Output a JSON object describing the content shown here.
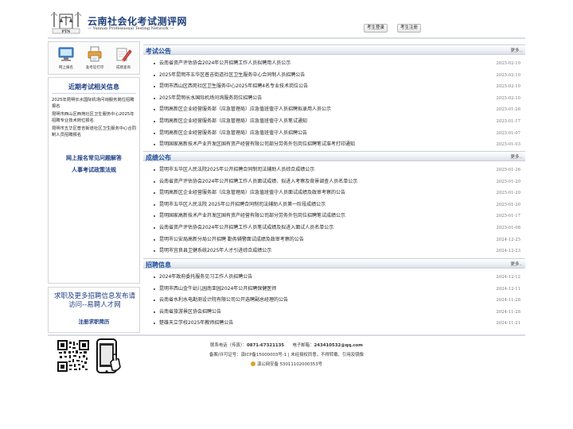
{
  "header": {
    "site_title": "云南社会化考试测评网",
    "site_subtitle": "Yunnan Professional Testing Network",
    "logo_text": "PTN",
    "login_label": "考生登录",
    "register_label": "考生注册"
  },
  "quick_links": [
    {
      "label": "网上报名",
      "icon": "computer-icon"
    },
    {
      "label": "准考证打印",
      "icon": "printer-icon"
    },
    {
      "label": "成绩查询",
      "icon": "pencil-icon"
    }
  ],
  "sidebar": {
    "title": "近期考试相关信息",
    "items": [
      "2025年昆明长水国际机场问询服务岗位招聘报名",
      "昆明市西山区西苑社区卫生服务中心2025年招聘专业技术岗位报名",
      "昆明市五华区普吉街道社区卫生服务中心合同制人员招聘报名"
    ],
    "link_faq": "网上报名常见问题解答",
    "link_policy": "人事考试政策法规"
  },
  "recruit": {
    "text": "求职及更多招聘信息发布请访问--易聘人才网",
    "link": "注册求职简历"
  },
  "sections": [
    {
      "title": "考试公告",
      "more": "更多..",
      "items": [
        {
          "title": "云南省资产评估协会2024年公开招聘工作人员拟聘用人员公示",
          "date": "2025-02-10"
        },
        {
          "title": "2025年昆明市五华区普吉街道社区卫生服务中心合同制人员招聘公告",
          "date": "2025-02-10"
        },
        {
          "title": "昆明市西山区西苑社区卫生服务中心2025年招聘4名专业技术岗位公告",
          "date": "2025-02-10"
        },
        {
          "title": "2025年昆明长水国际机场问询服务岗位招聘公告",
          "date": "2025-02-10"
        },
        {
          "title": "昆明高新区企业经营服务部（应急管理局）应急值班值守人员招聘拟录用人员公示",
          "date": "2025-01-26"
        },
        {
          "title": "昆明高新区企业经营服务部（应急管理局）应急值班值守人员笔试通知",
          "date": "2025-01-17"
        },
        {
          "title": "昆明高新区企业经营服务部（应急管理局）应急值班值守人员招聘公告",
          "date": "2025-01-07"
        },
        {
          "title": "昆明国家高新技术产业开发区国有资产经营有限公司部分劳务外包岗位招聘笔试准考打印通知",
          "date": "2025-01-03"
        }
      ]
    },
    {
      "title": "成绩公布",
      "more": "更多..",
      "items": [
        {
          "title": "昆明市五华区人民法院2025年公开招聘合同制司法辅助人员综合成绩公示",
          "date": "2025-01-26"
        },
        {
          "title": "云南省资产评估协会2024年公开招聘工作人员面试成绩、拟进入考察及背景调查人员名单公示",
          "date": "2025-01-20"
        },
        {
          "title": "昆明高新区企业经营服务部（应急管理局）应急值班值守人员面试成绩及政审考察的公告",
          "date": "2025-01-20"
        },
        {
          "title": "昆明市五华区人民法院 2025年公开招聘合同制司法辅助人员第一阶段成绩公示",
          "date": "2025-01-20"
        },
        {
          "title": "昆明国家高新技术产业开发区国有资产经营有限公司部分劳务外包岗位招聘笔试成绩公示",
          "date": "2025-01-17"
        },
        {
          "title": "云南省资产评估协会2024年公开招聘工作人员笔试成绩及拟进入面试人员名单公示",
          "date": "2025-01-08"
        },
        {
          "title": "昆明市公安局高新分局公开招聘 勤务辅警面试成绩及政审考察的公告",
          "date": "2024-12-25"
        },
        {
          "title": "昆明市宜良县卫健系统2025年人才引进综合成绩公示",
          "date": "2024-12-23"
        }
      ]
    },
    {
      "title": "招聘信息",
      "more": "更多..",
      "items": [
        {
          "title": "2024年政府委托服务见习工作人员招聘公告",
          "date": "2024-12-12"
        },
        {
          "title": "昆明市西山金牛幼儿园南亚园2024年公开招聘保健医师",
          "date": "2024-12-11"
        },
        {
          "title": "云南省水利水电勘测设计院有限公司公开选聘副总经理的公告",
          "date": "2024-11-28"
        },
        {
          "title": "云南省旅游景区协会招聘公告",
          "date": "2024-11-28"
        },
        {
          "title": "楚雄天立学校2025年教师招聘公告",
          "date": "2024-11-21"
        }
      ]
    }
  ],
  "footer": {
    "contact_label": "联系电话（传真）：",
    "phone": "0871-67321135",
    "email_label": "电子邮箱：",
    "email": "243410532@qq.com",
    "icp": "备案/许可证号：滇ICP备15000003号-1 | 未经授权同意，不得转载、引用及镜像",
    "police": "滇公网安备 53011102000353号"
  }
}
